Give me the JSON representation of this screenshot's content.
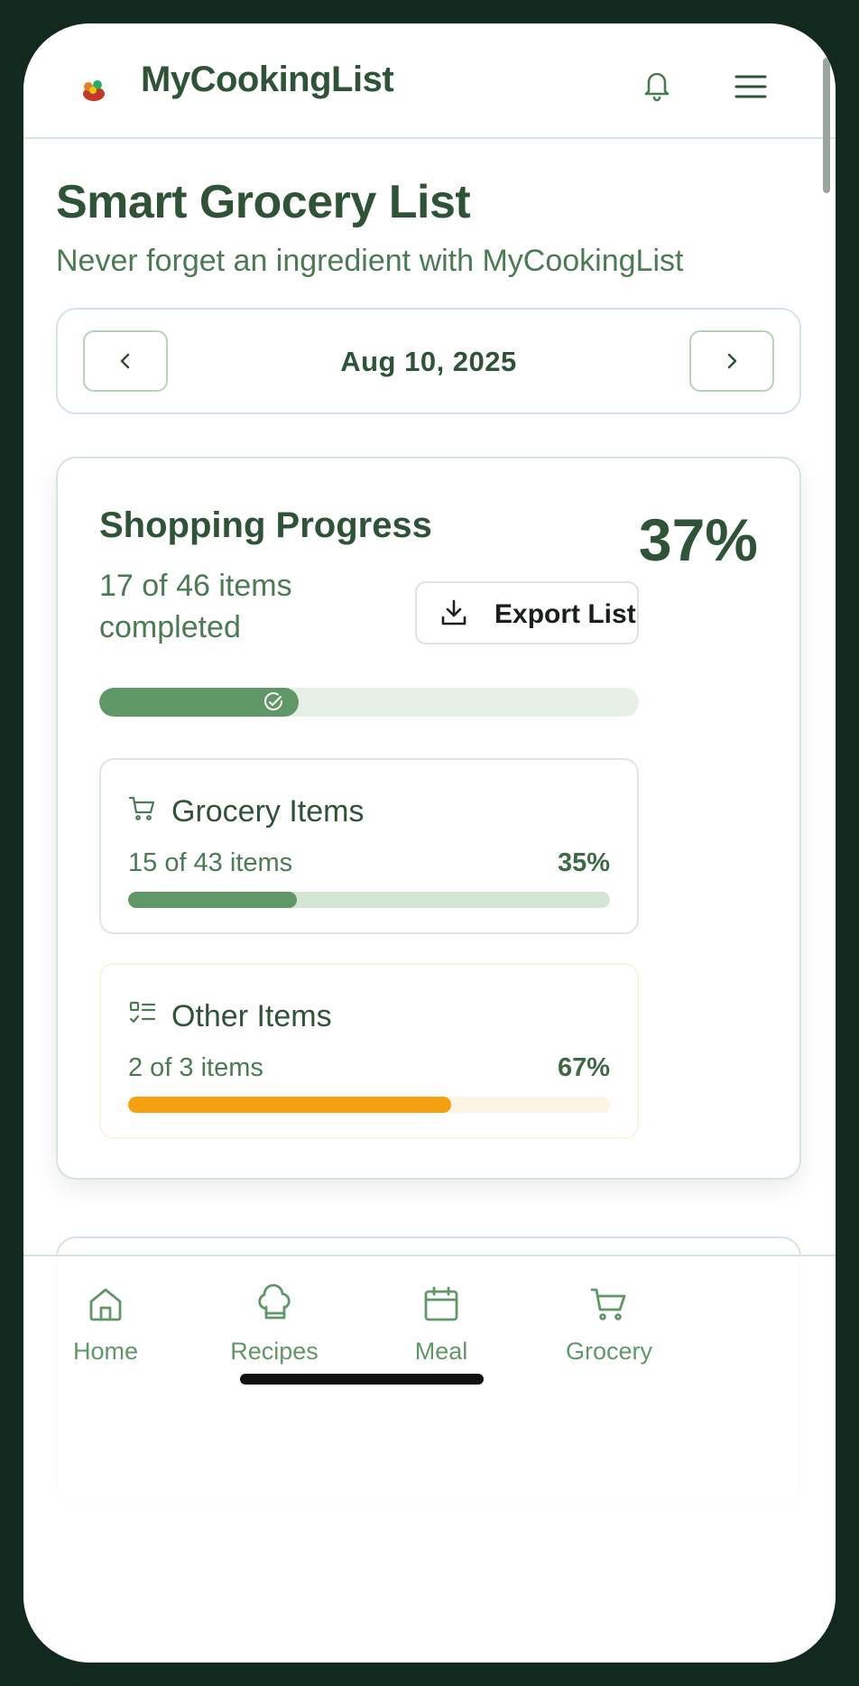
{
  "app": {
    "title": "MyCookingList"
  },
  "page": {
    "title": "Smart Grocery List",
    "subtitle": "Never forget an ingredient with MyCookingList"
  },
  "date_nav": {
    "date": "Aug 10, 2025"
  },
  "progress": {
    "title": "Shopping Progress",
    "percent_label": "37%",
    "fraction": 0.37,
    "summary": "17 of 46 items completed",
    "export_label": "Export List"
  },
  "categories": [
    {
      "name": "Grocery Items",
      "count": "15 of 43 items",
      "percent_label": "35%",
      "fraction": 0.35,
      "icon": "cart-icon"
    },
    {
      "name": "Other Items",
      "count": "2 of 3 items",
      "percent_label": "67%",
      "fraction": 0.67,
      "icon": "checklist-icon"
    }
  ],
  "bottom_nav": [
    {
      "label": "Home",
      "icon": "home-icon"
    },
    {
      "label": "Recipes",
      "icon": "chef-hat-icon"
    },
    {
      "label": "Meal",
      "icon": "calendar-icon"
    },
    {
      "label": "Grocery",
      "icon": "cart-icon"
    }
  ],
  "colors": {
    "primary": "#2f5336",
    "accent": "#5f9866",
    "other_accent": "#f5a010",
    "phone_frame": "#12291f"
  }
}
